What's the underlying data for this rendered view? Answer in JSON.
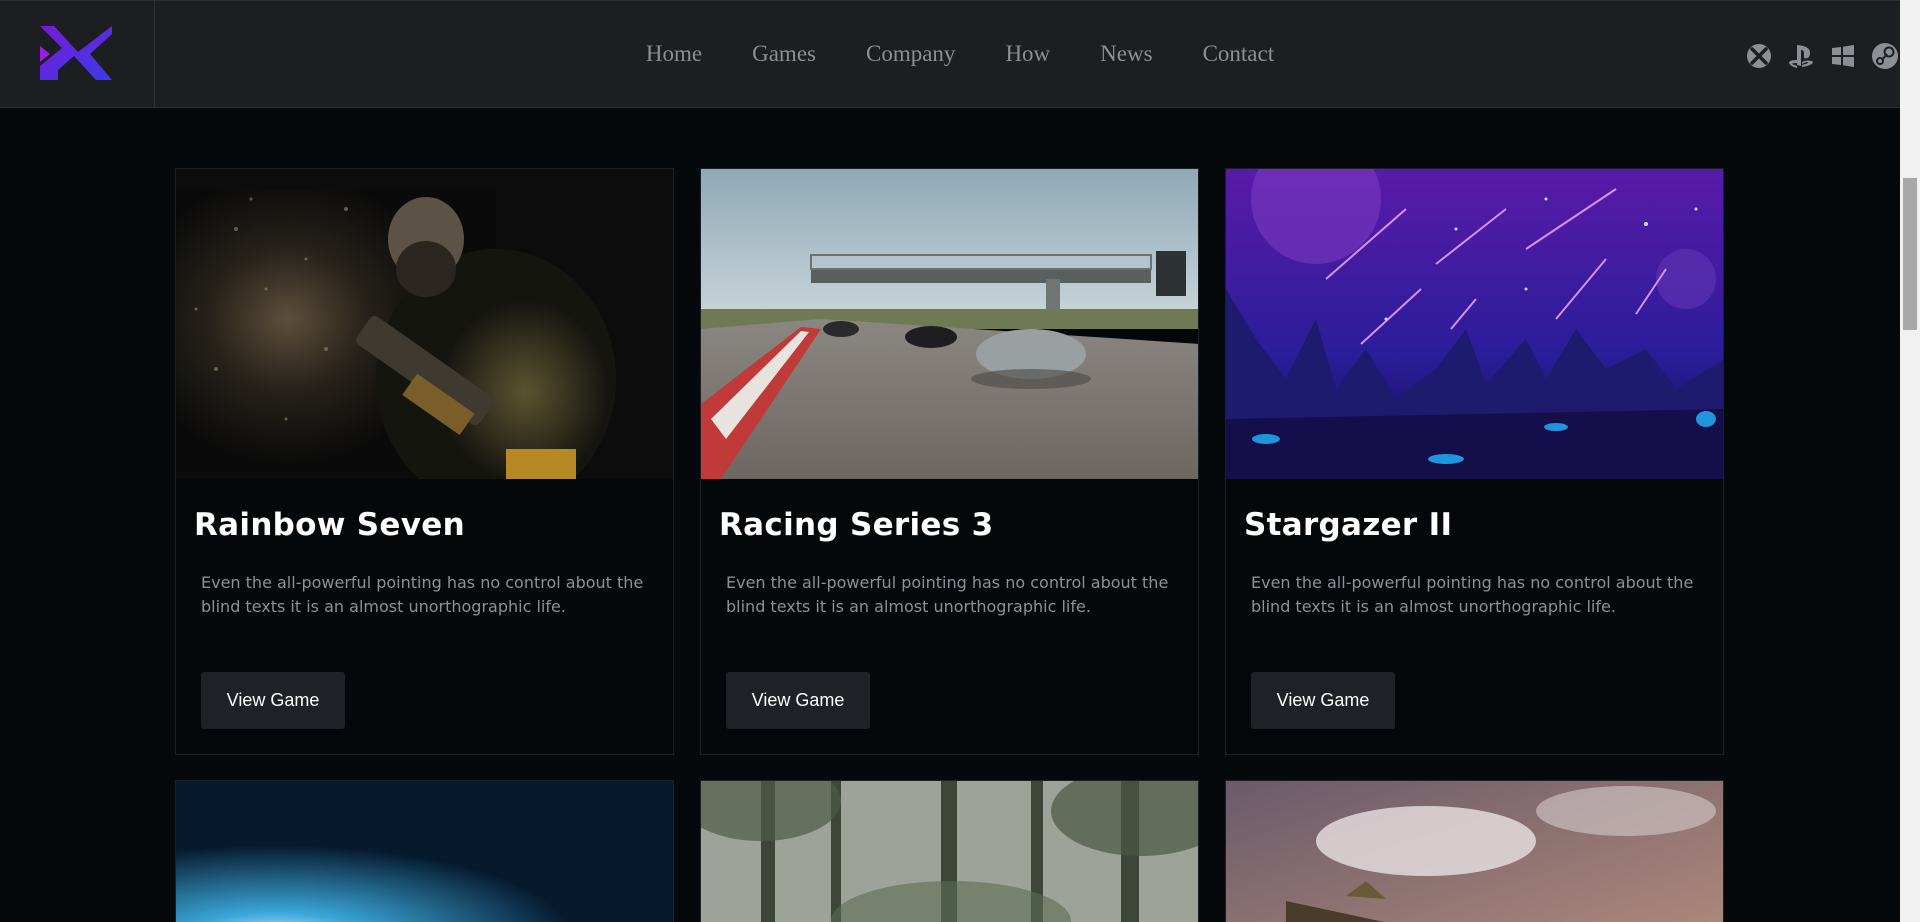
{
  "nav": {
    "items": [
      {
        "label": "Home"
      },
      {
        "label": "Games"
      },
      {
        "label": "Company"
      },
      {
        "label": "How"
      },
      {
        "label": "News"
      },
      {
        "label": "Contact"
      }
    ]
  },
  "platforms": [
    "xbox-icon",
    "playstation-icon",
    "windows-icon",
    "steam-icon"
  ],
  "cards": [
    {
      "title": "Rainbow Seven",
      "description": "Even the all-powerful pointing has no control about the blind texts it is an almost unorthographic life.",
      "button": "View Game"
    },
    {
      "title": "Racing Series 3",
      "description": "Even the all-powerful pointing has no control about the blind texts it is an almost unorthographic life.",
      "button": "View Game"
    },
    {
      "title": "Stargazer II",
      "description": "Even the all-powerful pointing has no control about the blind texts it is an almost unorthographic life.",
      "button": "View Game"
    }
  ],
  "colors": {
    "background": "#05090c",
    "header": "#1c1e22",
    "logo_gradient_start": "#7a1bd6",
    "logo_gradient_end": "#3a3bea",
    "nav_text": "#8c8f94",
    "button_bg": "#1e2126"
  }
}
